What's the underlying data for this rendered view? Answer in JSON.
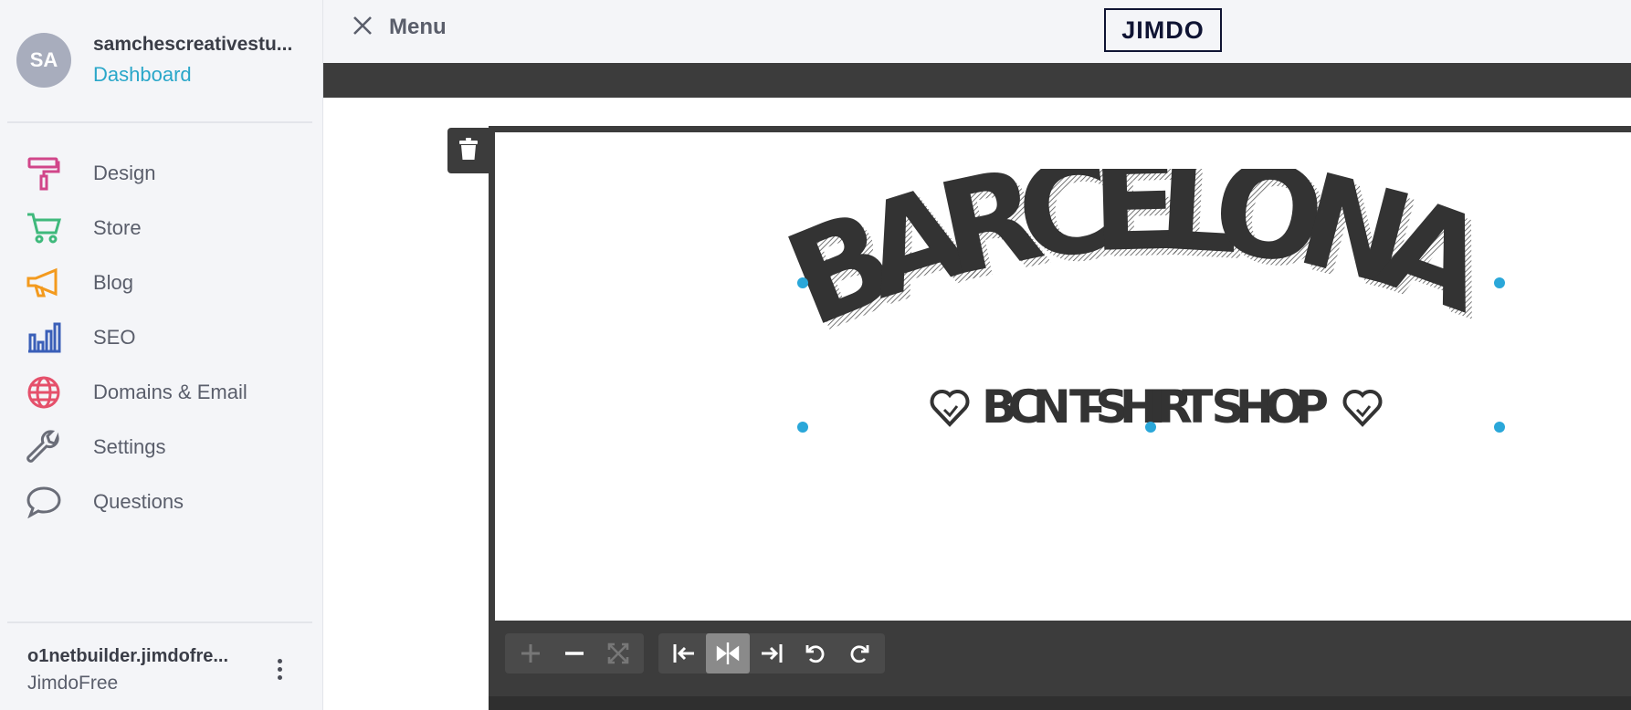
{
  "profile": {
    "initials": "SA",
    "name": "samchescreativestu...",
    "dashboard_link": "Dashboard"
  },
  "nav": [
    {
      "label": "Design",
      "icon": "paint-roller-icon",
      "color": "#d1468a"
    },
    {
      "label": "Store",
      "icon": "cart-icon",
      "color": "#3fb97c"
    },
    {
      "label": "Blog",
      "icon": "megaphone-icon",
      "color": "#f39a1e"
    },
    {
      "label": "SEO",
      "icon": "bar-chart-icon",
      "color": "#3a5fb8"
    },
    {
      "label": "Domains & Email",
      "icon": "globe-icon",
      "color": "#e5506b"
    },
    {
      "label": "Settings",
      "icon": "wrench-icon",
      "color": "#6a6d78"
    },
    {
      "label": "Questions",
      "icon": "speech-bubble-icon",
      "color": "#6a6d78"
    }
  ],
  "site": {
    "name": "o1netbuilder.jimdofre...",
    "plan": "JimdoFree"
  },
  "topbar": {
    "menu_label": "Menu",
    "logo_text": "JIMDO"
  },
  "image": {
    "headline": "BARCELONA",
    "subline": "BCN T-SHIRT SHOP"
  },
  "toolbar": {
    "zoom_tools": [
      "zoom-in-icon",
      "zoom-out-icon",
      "fit-icon"
    ],
    "align_tools": [
      "align-left-icon",
      "align-center-icon",
      "align-right-icon",
      "rotate-left-icon",
      "rotate-right-icon"
    ],
    "active_tool": "align-center-icon"
  },
  "colors": {
    "accent": "#2aa7c9",
    "editor_dark": "#3c3c3c",
    "logo_navy": "#0f1433",
    "art_dark": "#333333"
  }
}
